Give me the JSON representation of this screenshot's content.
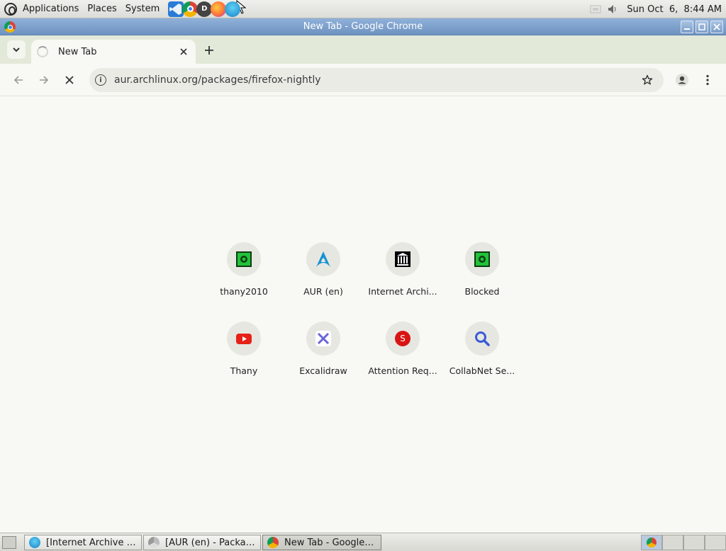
{
  "top_panel": {
    "menus": [
      "Applications",
      "Places",
      "System"
    ],
    "clock": "Sun Oct  6,  8:44 AM"
  },
  "window": {
    "title": "New Tab - Google Chrome"
  },
  "tabs": [
    {
      "title": "New Tab",
      "loading": true
    }
  ],
  "toolbar": {
    "url": "aur.archlinux.org/packages/firefox-nightly"
  },
  "shortcuts": [
    {
      "label": "thany2010",
      "icon": "green-square-icon",
      "bg": "#1c8a2e"
    },
    {
      "label": "AUR (en)",
      "icon": "arch-logo-icon",
      "bg": "#1793d1"
    },
    {
      "label": "Internet Archi...",
      "icon": "museum-icon",
      "bg": "#000000"
    },
    {
      "label": "Blocked",
      "icon": "green-square-icon",
      "bg": "#1c8a2e"
    },
    {
      "label": "Thany",
      "icon": "youtube-icon",
      "bg": "#e62117"
    },
    {
      "label": "Excalidraw",
      "icon": "excalidraw-icon",
      "bg": "#6965db"
    },
    {
      "label": "Attention Req...",
      "icon": "red-s-icon",
      "bg": "#d81414"
    },
    {
      "label": "CollabNet Se...",
      "icon": "magnifier-icon",
      "bg": "#3b5bd8"
    }
  ],
  "taskbar": {
    "tasks": [
      {
        "title": "[Internet Archive Bl...",
        "active": false
      },
      {
        "title": "[AUR (en) - Package...",
        "active": false
      },
      {
        "title": "New Tab - Google C...",
        "active": true
      }
    ]
  }
}
